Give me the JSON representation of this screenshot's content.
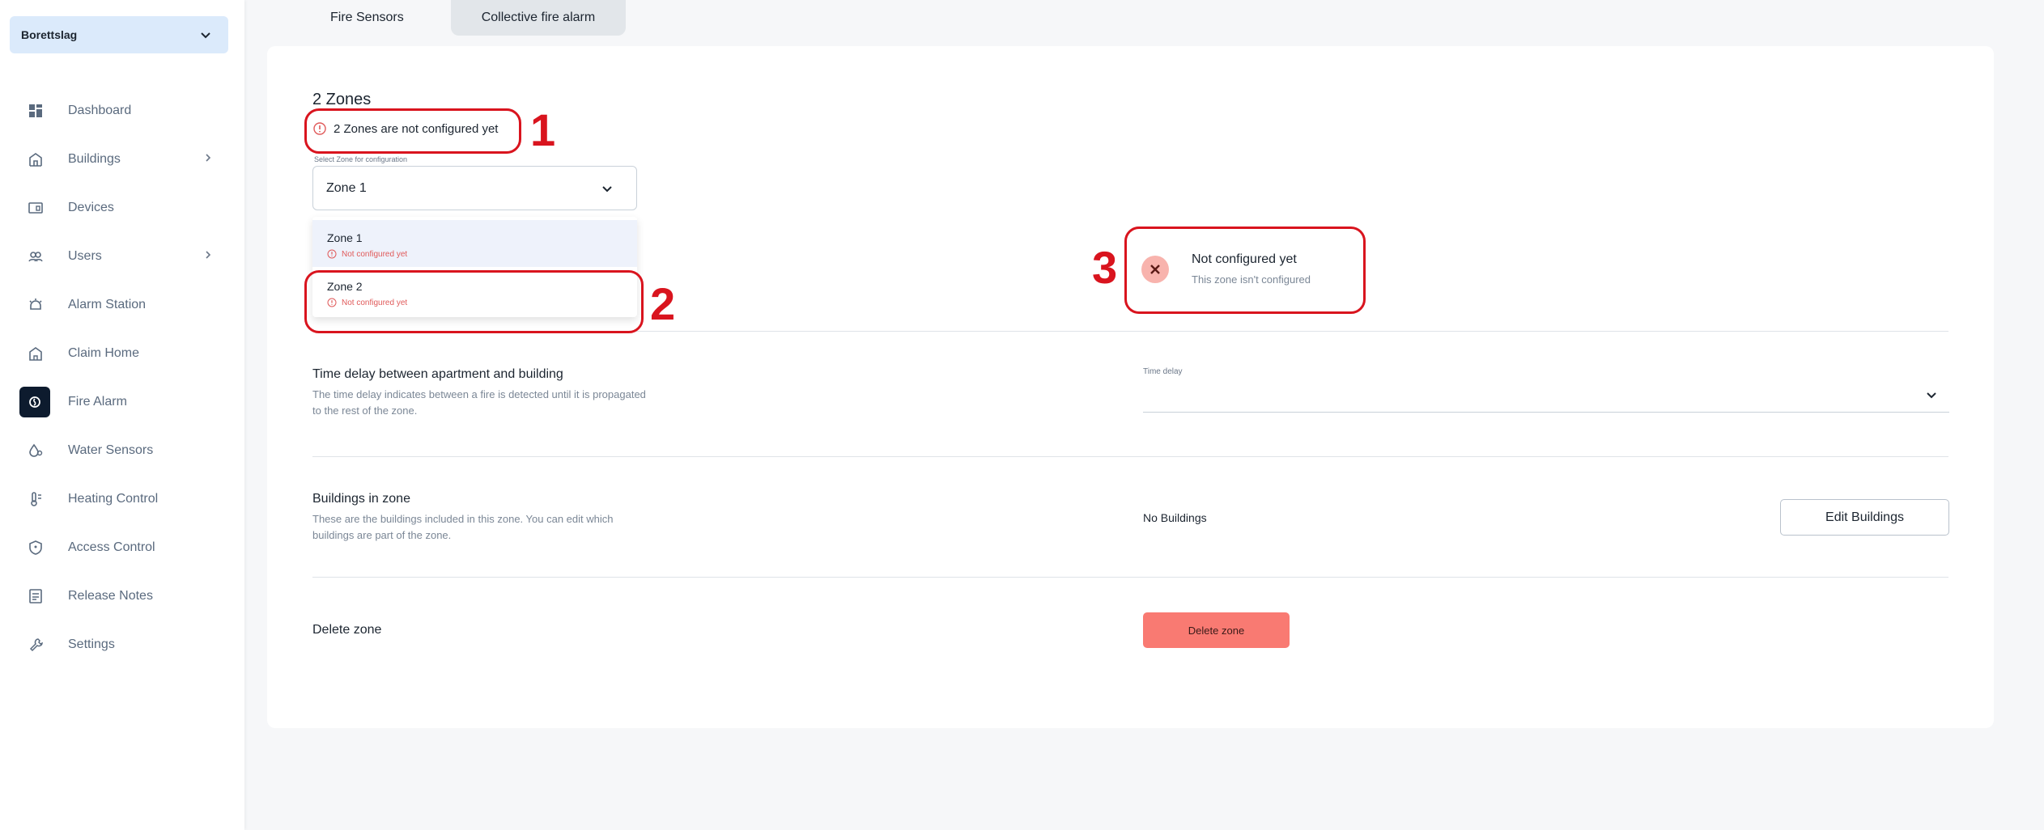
{
  "sidebar": {
    "org_name": "Borettslag",
    "items": [
      {
        "label": "Dashboard",
        "icon": "dashboard-icon"
      },
      {
        "label": "Buildings",
        "icon": "buildings-icon",
        "chevron": true
      },
      {
        "label": "Devices",
        "icon": "devices-icon"
      },
      {
        "label": "Users",
        "icon": "users-icon",
        "chevron": true
      },
      {
        "label": "Alarm Station",
        "icon": "alarm-station-icon"
      },
      {
        "label": "Claim Home",
        "icon": "claim-home-icon"
      },
      {
        "label": "Fire Alarm",
        "icon": "fire-alarm-icon",
        "active": true
      },
      {
        "label": "Water Sensors",
        "icon": "water-sensors-icon"
      },
      {
        "label": "Heating Control",
        "icon": "heating-control-icon"
      },
      {
        "label": "Access Control",
        "icon": "access-control-icon"
      },
      {
        "label": "Release Notes",
        "icon": "release-notes-icon"
      },
      {
        "label": "Settings",
        "icon": "settings-icon"
      }
    ]
  },
  "tabs": [
    {
      "label": "Fire Sensors"
    },
    {
      "label": "Collective fire alarm",
      "active": true
    }
  ],
  "zones": {
    "title": "2 Zones",
    "warning": "2 Zones are not configured yet",
    "select_label": "Select Zone for configuration",
    "selected": "Zone 1",
    "options": [
      {
        "name": "Zone 1",
        "status": "Not configured yet"
      },
      {
        "name": "Zone 2",
        "status": "Not configured yet"
      }
    ]
  },
  "status": {
    "title": "Not configured yet",
    "subtitle": "This zone isn't configured"
  },
  "time_delay": {
    "title": "Time delay between apartment and building",
    "description": "The time delay indicates between a fire is detected until it is propagated to the rest of the zone.",
    "field_label": "Time delay",
    "value": ""
  },
  "buildings": {
    "title": "Buildings in zone",
    "description": "These are the buildings included in this zone. You can edit which buildings are part of the zone.",
    "value": "No Buildings",
    "edit_label": "Edit Buildings"
  },
  "delete": {
    "title": "Delete zone",
    "button_label": "Delete zone"
  },
  "annotations": [
    "1",
    "2",
    "3"
  ],
  "colors": {
    "accent_dark": "#0d1b2e",
    "selected_bg": "#dbeafb",
    "error": "#e05a5a",
    "delete_button": "#f97a72",
    "annotation": "#d9141e"
  }
}
